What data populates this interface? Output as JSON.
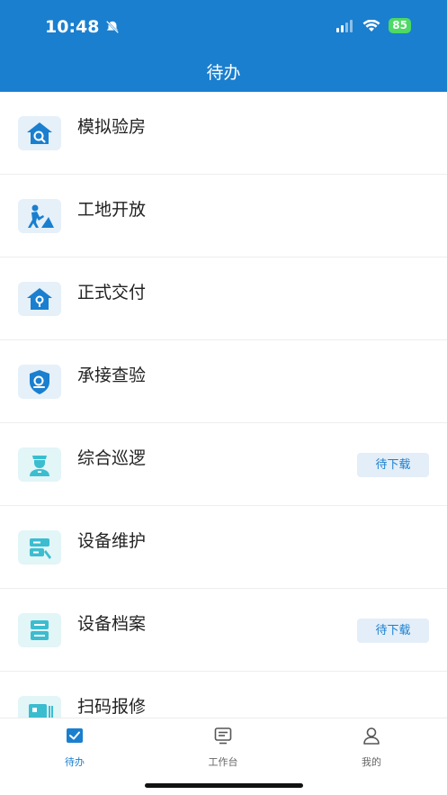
{
  "status_bar": {
    "time": "10:48",
    "battery": "85"
  },
  "header": {
    "title": "待办"
  },
  "list": {
    "items": [
      {
        "label": "模拟验房",
        "icon": "house-search-icon",
        "badge": ""
      },
      {
        "label": "工地开放",
        "icon": "construction-worker-icon",
        "badge": ""
      },
      {
        "label": "正式交付",
        "icon": "house-key-icon",
        "badge": ""
      },
      {
        "label": "承接查验",
        "icon": "shield-search-icon",
        "badge": ""
      },
      {
        "label": "综合巡逻",
        "icon": "security-guard-icon",
        "badge": "待下载"
      },
      {
        "label": "设备维护",
        "icon": "server-wrench-icon",
        "badge": ""
      },
      {
        "label": "设备档案",
        "icon": "server-file-icon",
        "badge": "待下载"
      },
      {
        "label": "扫码报修",
        "icon": "scan-repair-icon",
        "badge": ""
      }
    ]
  },
  "tabbar": {
    "tabs": [
      {
        "label": "待办",
        "icon": "todo-check-icon",
        "active": true
      },
      {
        "label": "工作台",
        "icon": "workbench-icon",
        "active": false
      },
      {
        "label": "我的",
        "icon": "user-icon",
        "active": false
      }
    ]
  },
  "colors": {
    "brand": "#1a7fcf",
    "icon_bg": "#e5f0f9",
    "icon_bg_teal": "#e2f5f7",
    "teal": "#3bbdd0"
  }
}
